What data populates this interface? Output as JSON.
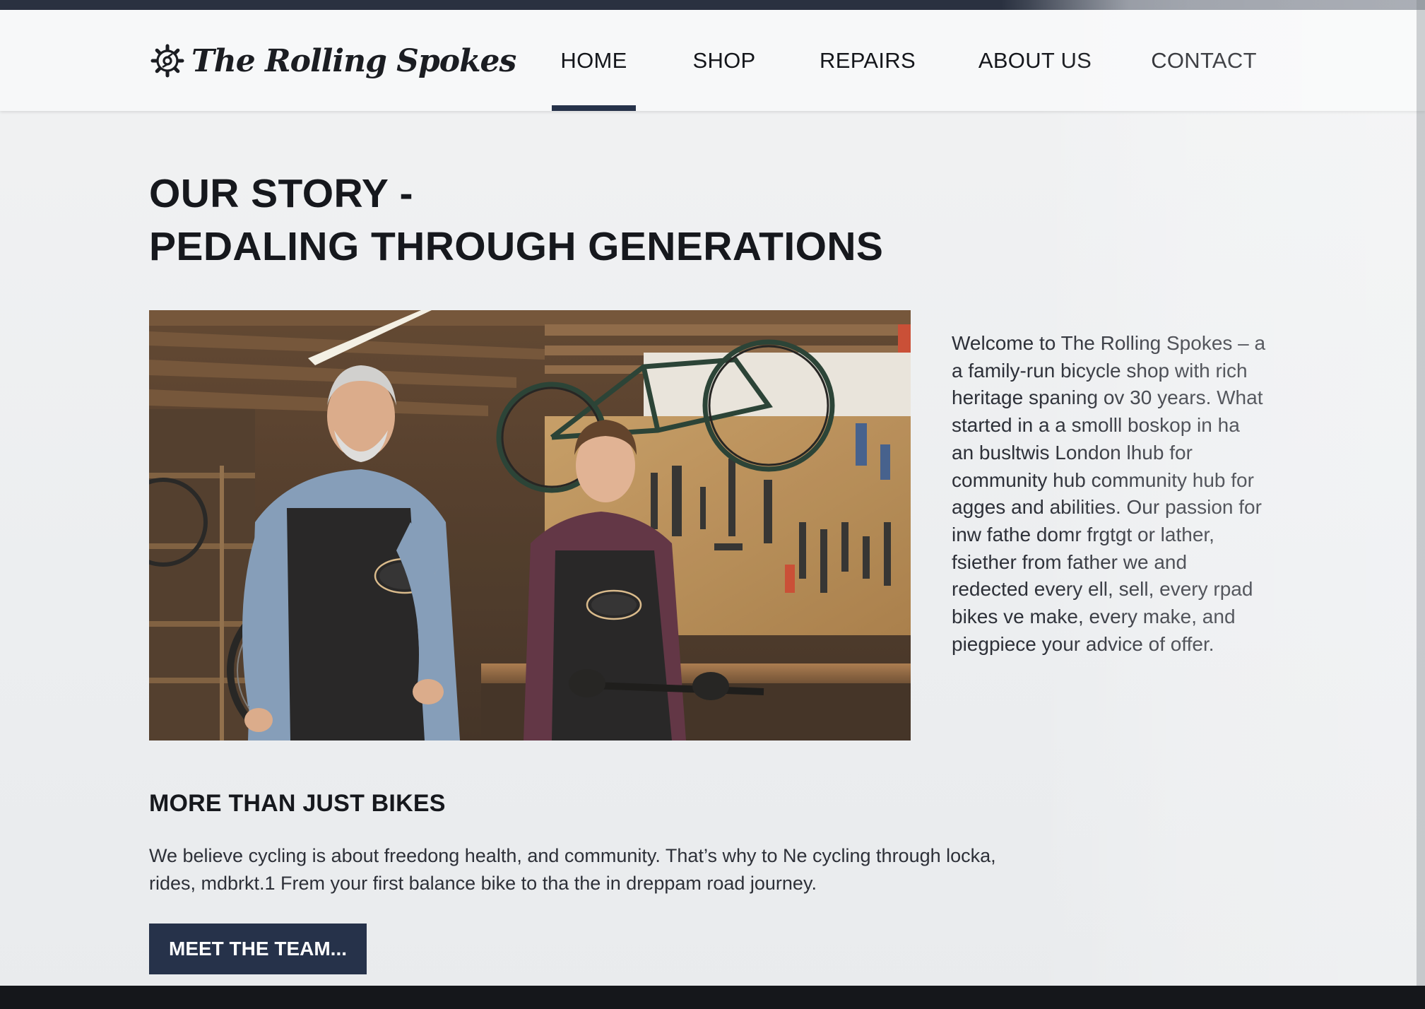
{
  "header": {
    "brand": "The Rolling Spokes",
    "logo_icon": "gear-icon"
  },
  "nav": {
    "items": [
      {
        "label": "HOME",
        "active": true
      },
      {
        "label": "SHOP",
        "active": false
      },
      {
        "label": "REPAIRS",
        "active": false
      },
      {
        "label": "ABOUT US",
        "active": false
      },
      {
        "label": "CONTACT",
        "active": false
      }
    ]
  },
  "hero": {
    "title_line1": "OUR STORY -",
    "title_line2": "PEDALING THROUGH GENERATIONS",
    "story_lines": [
      "Welcome to The Rolling Spokes – a",
      "a family-run bicycle shop with rich",
      "heritage spaning ov 30 years. What",
      "started in a a smolll  boskop in ha",
      "an busltwis London lhub for",
      "community hub community hub for",
      "agges and abilities. Our passion for",
      "inw fathe domr frgtgt or lather,",
      "fsiether from father we and",
      "redected every ell, sell, every rpad",
      "bikes ve make, every make, and",
      "piegpiece your advice of offer."
    ]
  },
  "section": {
    "heading": "MORE THAN JUST BIKES",
    "body_lines": [
      "We believe cycling is about freedong health, and community. That’s why to Ne cycling through locka,",
      "rides, mdbrkt.1 Frem your first balance bike to tha the in dreppam road journey."
    ],
    "cta_label": "MEET THE TEAM..."
  },
  "colors": {
    "accent": "#26324a",
    "footer": "#15171b",
    "text": "#16181d"
  }
}
